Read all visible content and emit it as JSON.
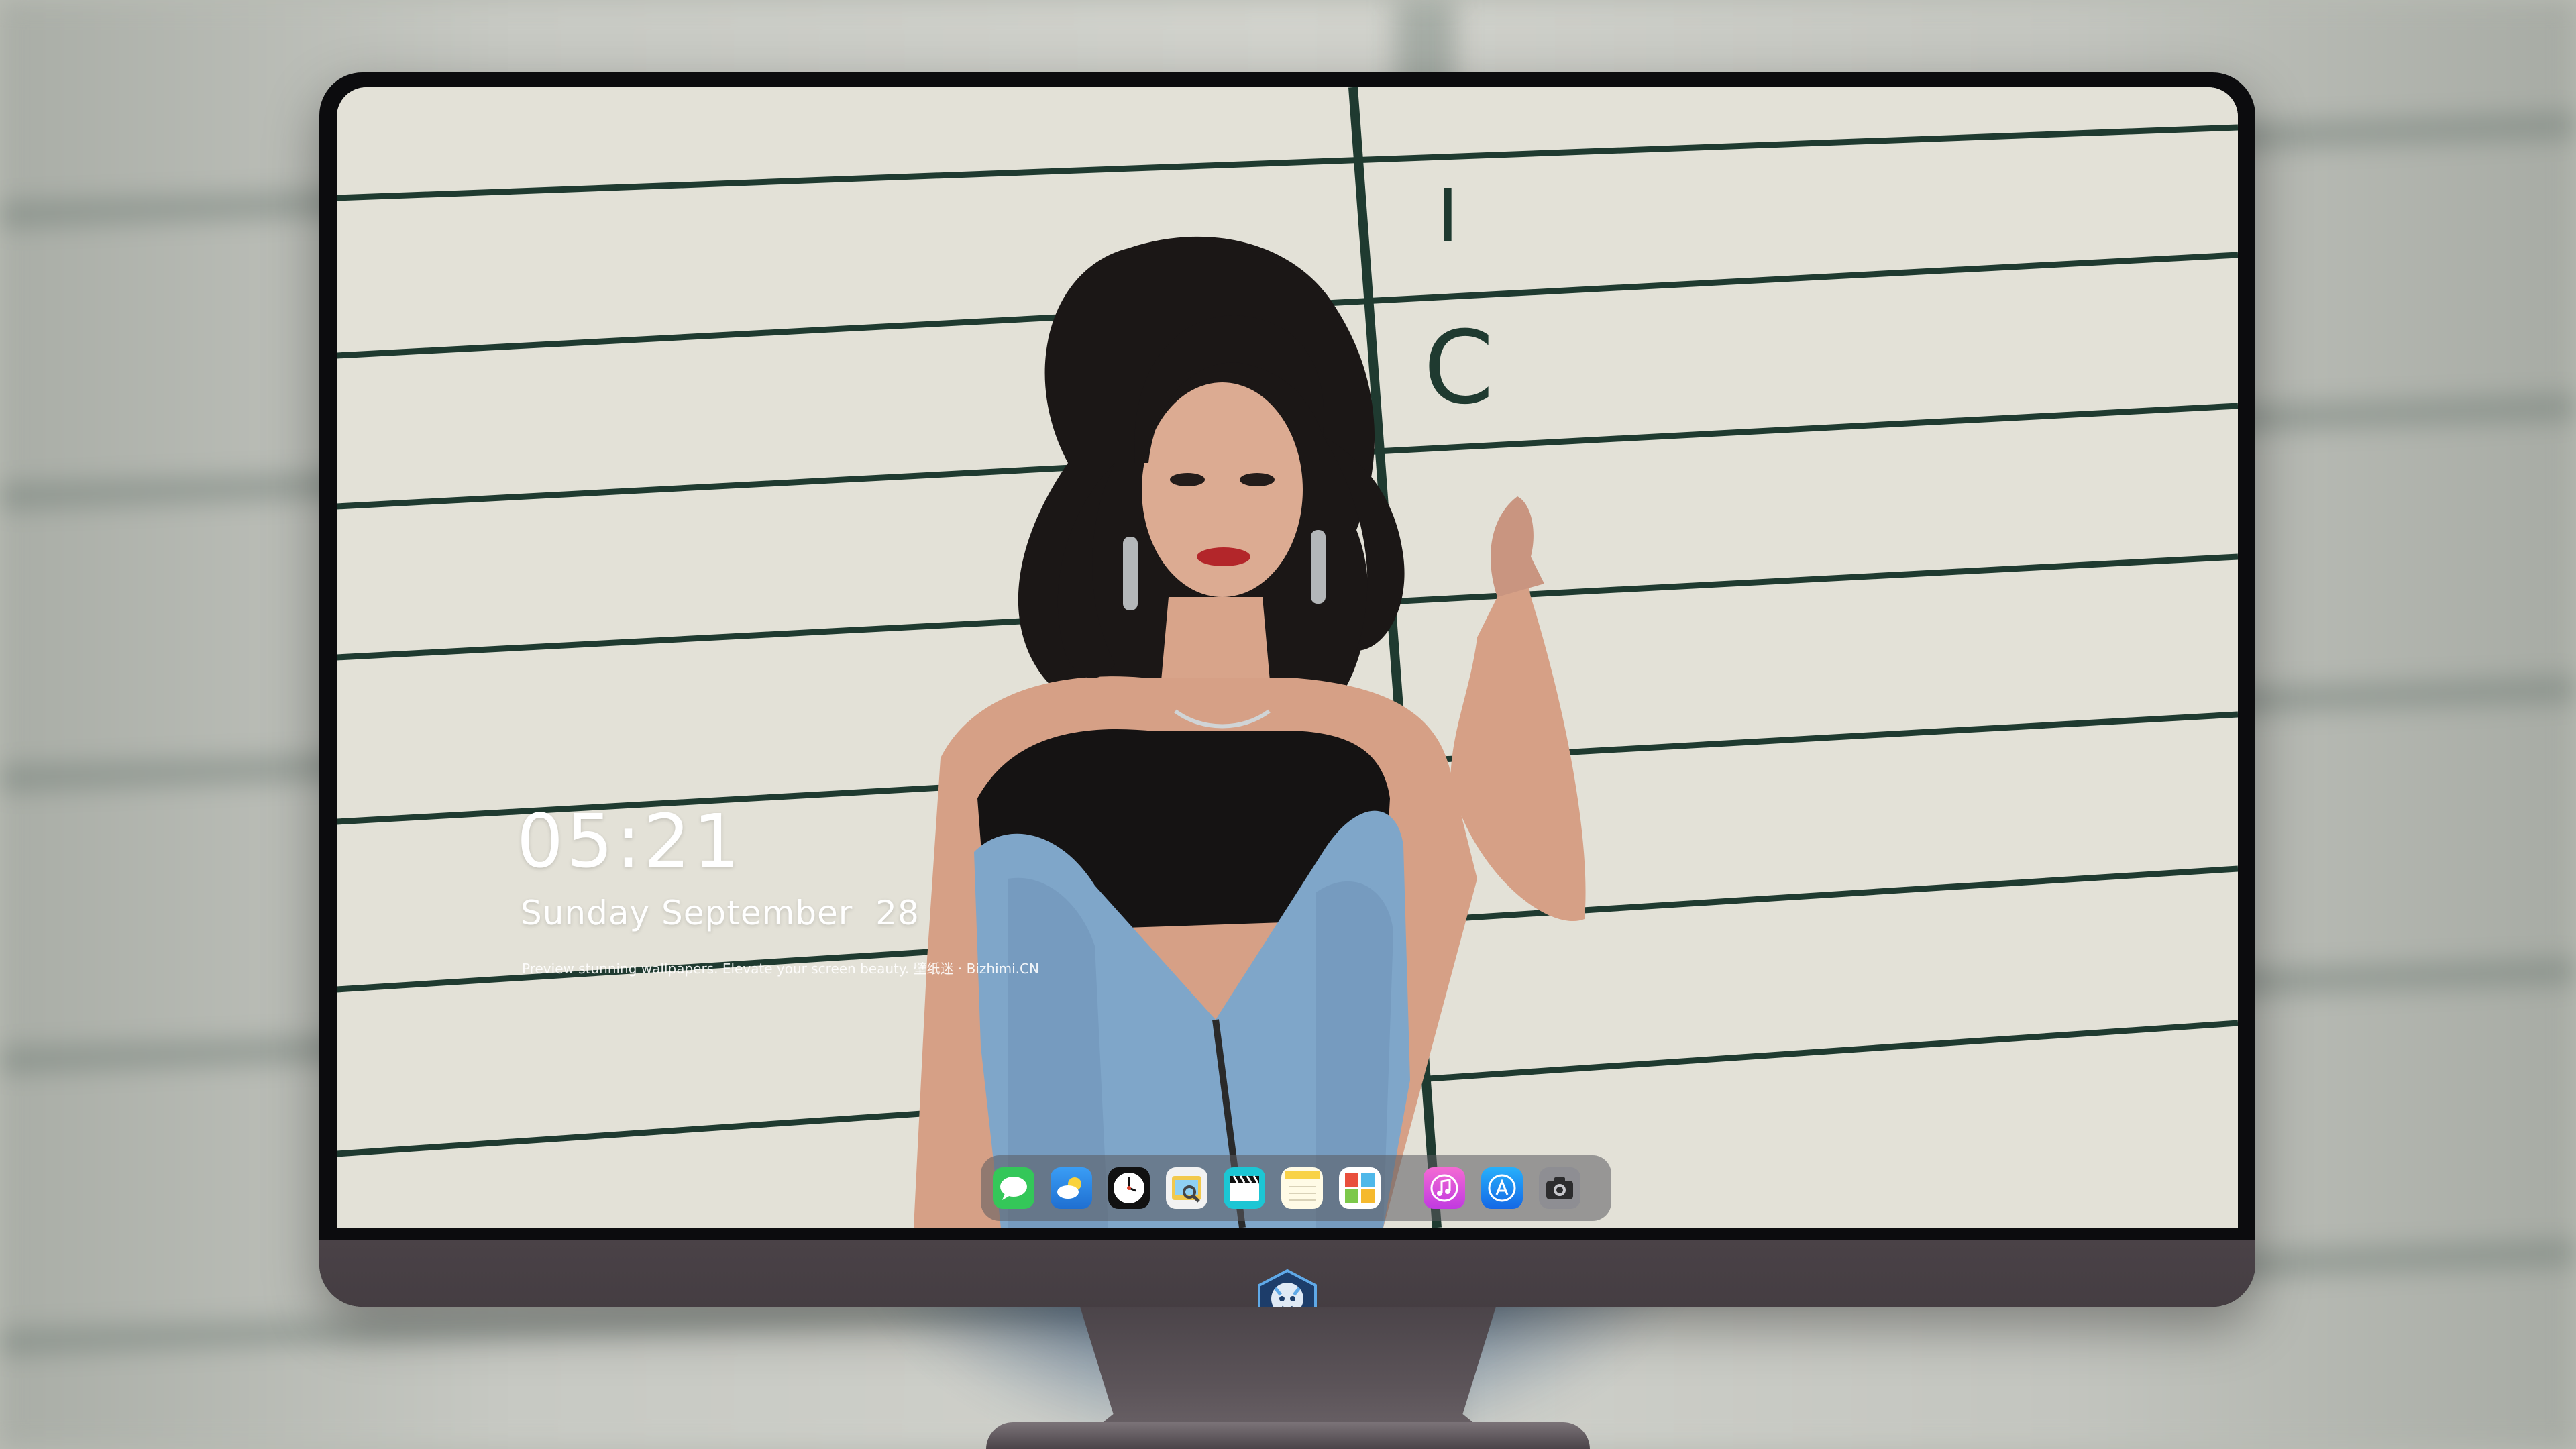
{
  "lockscreen": {
    "time": "05:21",
    "date": "Sunday September  28",
    "tagline": "Preview stunning wallpapers. Elevate your screen beauty. 壁纸迷 · Bizhimi.CN"
  },
  "wall_letters": [
    "I",
    "C"
  ],
  "dock": {
    "apps": [
      {
        "name": "messages-icon",
        "color": "#34c759"
      },
      {
        "name": "weather-icon",
        "color": "#2f8ef3"
      },
      {
        "name": "clock-icon",
        "color": "#111111"
      },
      {
        "name": "preview-icon",
        "color": "#f2c94c"
      },
      {
        "name": "clips-icon",
        "color": "#1cc6d4"
      },
      {
        "name": "notes-icon",
        "color": "#f8d247"
      },
      {
        "name": "photo-booth-icon",
        "color": "#e94f3d"
      },
      {
        "name": "music-icon",
        "color": "#f153c4"
      },
      {
        "name": "app-store-icon",
        "color": "#1a8cf5"
      },
      {
        "name": "camera-icon",
        "color": "#6e6e73"
      }
    ]
  },
  "colors": {
    "wall": "#e3e1d7",
    "wall_line": "#1f3a30",
    "bezel": "#0c0c0e",
    "chin": "#453e43"
  }
}
